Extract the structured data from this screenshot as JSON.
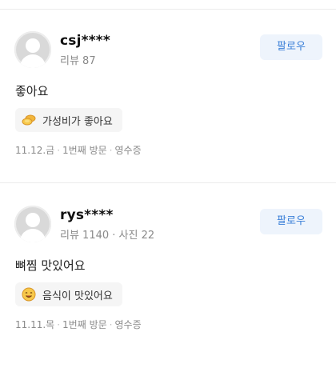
{
  "reviews": [
    {
      "username": "csj****",
      "meta": "리뷰 87",
      "follow_label": "팔로우",
      "text": "좋아요",
      "chip": {
        "icon": "coin-icon",
        "label": "가성비가 좋아요"
      },
      "footer": {
        "date": "11.12.금",
        "visit": "1번째 방문",
        "receipt": "영수증"
      }
    },
    {
      "username": "rys****",
      "meta": "리뷰 1140 · 사진 22",
      "follow_label": "팔로우",
      "text": "뼈찜 맛있어요",
      "chip": {
        "icon": "yum-face-icon",
        "label": "음식이 맛있어요"
      },
      "footer": {
        "date": "11.11.목",
        "visit": "1번째 방문",
        "receipt": "영수증"
      }
    }
  ],
  "colors": {
    "follow_bg": "#eef4fc",
    "follow_text": "#3a7fd8",
    "chip_bg": "#f5f5f5",
    "meta_text": "#8a8a8a"
  }
}
